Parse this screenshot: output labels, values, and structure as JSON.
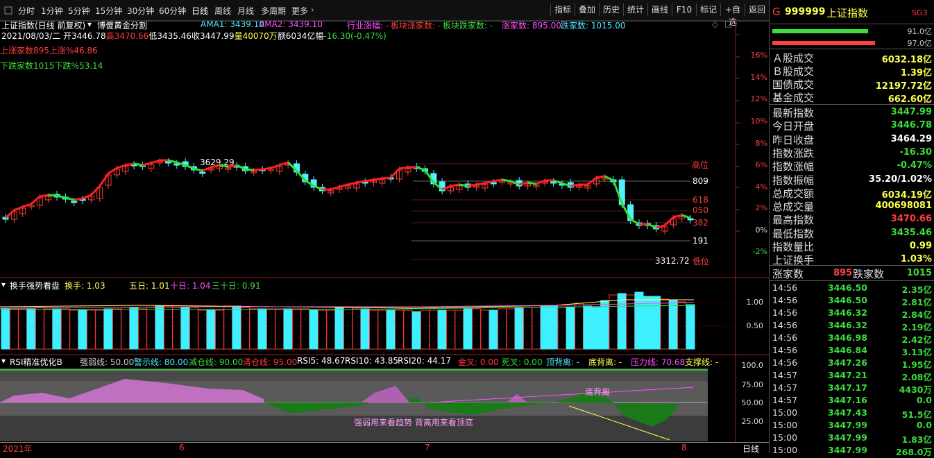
{
  "toolbar": {
    "periods": [
      "分时",
      "1分钟",
      "5分钟",
      "15分钟",
      "30分钟",
      "60分钟",
      "日线",
      "周线",
      "月线",
      "多周期",
      "更多"
    ],
    "active_period": "日线",
    "buttons": [
      "指标",
      "叠加",
      "历史",
      "统计",
      "画线",
      "F10",
      "标记",
      "+自选",
      "返回"
    ]
  },
  "main": {
    "title": "上证指数(日线 前复权)",
    "indicator": "博傻黄金分割",
    "ama1": "AMA1: 3439.10",
    "ama2": "AMA2: 3439.10",
    "industry": "行业涨幅: -",
    "block_up": "板块涨家数: -",
    "block_down": "板块跌家数: -",
    "up_count": "涨家数: 895.00",
    "down_count": "跌家数: 1015.00",
    "date_line_a": "2021/08/03/二 开",
    "open": "3446.78",
    "high_lab": "高",
    "high": "3470.66",
    "low_lab": "低",
    "low": "3435.46",
    "close_lab": "收",
    "close": "3447.99",
    "vol_lab": "量",
    "vol": "40070万",
    "amt_lab": "额",
    "amt": "6034亿",
    "chg_lab": "幅",
    "chg": "-16.30(-0.47%)",
    "up_stat": "上涨家数895上涨%46.86",
    "down_stat": "下跌家数1015下跌%53.14",
    "pct_ticks": [
      "16%",
      "14%",
      "12%",
      "10%",
      "8%",
      "6%",
      "4%",
      "2%",
      "0%",
      "-2%"
    ],
    "levels": {
      "high": "高位",
      "l809": "809",
      "l618": "618",
      "l050": "050",
      "l382": "382",
      "l191": "191",
      "low": "低位"
    },
    "peak_label": "3629.29",
    "trough_label": "3312.72"
  },
  "turnover": {
    "title": "换手强势看盘",
    "huanshou": "换手: 1.03",
    "d5": "五日: 1.01",
    "d10": "十日: 1.04",
    "d30": "三十日: 0.91",
    "ticks": [
      "1.00",
      "0.50"
    ]
  },
  "rsi": {
    "title": "RSI精准优化B",
    "strong": "强弱线: 50.00",
    "warn": "警示线: 80.00",
    "reduce": "减仓线: 90.00",
    "clear": "清仓线: 95.00",
    "rsi5": "RSI5: 48.67",
    "rsi10": "RSI10: 43.85",
    "rsi20": "RSI20: 44.17",
    "golden": "金叉: 0.00",
    "death": "死叉: 0.00",
    "top_div": "顶背离: -",
    "bottom_div": "底背离: -",
    "pressure": "压力线: 70.68",
    "support": "支撑线: -",
    "ticks": [
      "100.0",
      "75.00",
      "50.00",
      "25.00"
    ],
    "note": "强弱用来看趋势 背离用来看顶底",
    "div_label": "底背离"
  },
  "timeaxis": {
    "labels": [
      "2021年",
      "6",
      "7",
      "8"
    ],
    "mode": "日线"
  },
  "quote": {
    "code": "999999",
    "name": "上证指数",
    "prefix": "G",
    "sg": "SG3",
    "bar1": "91.0亿",
    "bar2": "97.0亿",
    "rows1": [
      {
        "label": "Ａ股成交",
        "value": "6032.18亿",
        "color": "#ffff50"
      },
      {
        "label": "Ｂ股成交",
        "value": "1.39亿",
        "color": "#ffff50"
      },
      {
        "label": "国债成交",
        "value": "12197.72亿",
        "color": "#ffff50"
      },
      {
        "label": "基金成交",
        "value": "662.60亿",
        "color": "#ffff50"
      }
    ],
    "rows2": [
      {
        "label": "最新指数",
        "value": "3447.99",
        "color": "#3cdc3c"
      },
      {
        "label": "今日开盘",
        "value": "3446.78",
        "color": "#3cdc3c"
      },
      {
        "label": "昨日收盘",
        "value": "3464.29",
        "color": "#ffffff"
      },
      {
        "label": "指数涨跌",
        "value": "-16.30",
        "color": "#3cdc3c"
      },
      {
        "label": "指数涨幅",
        "value": "-0.47%",
        "color": "#3cdc3c"
      },
      {
        "label": "指数振幅",
        "value": "35.20/1.02%",
        "color": "#ffffff"
      },
      {
        "label": "总成交额",
        "value": "6034.19亿",
        "color": "#ffff50"
      },
      {
        "label": "总成交量",
        "value": "400698081",
        "color": "#ffff50"
      },
      {
        "label": "最高指数",
        "value": "3470.66",
        "color": "#ff3c3c"
      },
      {
        "label": "最低指数",
        "value": "3435.46",
        "color": "#3cdc3c"
      },
      {
        "label": "指数量比",
        "value": "0.99",
        "color": "#ffff50"
      },
      {
        "label": "上证换手",
        "value": "1.03%",
        "color": "#ffff50"
      }
    ],
    "up_label": "涨家数",
    "up_value": "895",
    "down_label": "跌家数",
    "down_value": "1015",
    "ticks": [
      {
        "t": "14:56",
        "p": "3446.50",
        "v": "2.35亿",
        "c": "#3cdc3c"
      },
      {
        "t": "14:56",
        "p": "3446.50",
        "v": "2.81亿",
        "c": "#3cdc3c"
      },
      {
        "t": "14:56",
        "p": "3446.32",
        "v": "2.84亿",
        "c": "#3cdc3c"
      },
      {
        "t": "14:56",
        "p": "3446.32",
        "v": "2.19亿",
        "c": "#3cdc3c"
      },
      {
        "t": "14:56",
        "p": "3446.98",
        "v": "2.42亿",
        "c": "#3cdc3c"
      },
      {
        "t": "14:56",
        "p": "3446.84",
        "v": "3.13亿",
        "c": "#3cdc3c"
      },
      {
        "t": "14:56",
        "p": "3447.26",
        "v": "1.95亿",
        "c": "#3cdc3c"
      },
      {
        "t": "14:57",
        "p": "3447.21",
        "v": "2.08亿",
        "c": "#3cdc3c"
      },
      {
        "t": "14:57",
        "p": "3447.17",
        "v": "4430万",
        "c": "#3cdc3c"
      },
      {
        "t": "14:57",
        "p": "3447.16",
        "v": "0.0",
        "c": "#3cdc3c"
      },
      {
        "t": "15:00",
        "p": "3447.43",
        "v": "51.5亿",
        "c": "#3cdc3c"
      },
      {
        "t": "15:00",
        "p": "3447.99",
        "v": "0.0",
        "c": "#3cdc3c"
      },
      {
        "t": "15:00",
        "p": "3447.99",
        "v": "1.83亿",
        "c": "#3cdc3c"
      },
      {
        "t": "15:00",
        "p": "3447.99",
        "v": "268.0万",
        "c": "#3cdc3c"
      }
    ]
  }
}
